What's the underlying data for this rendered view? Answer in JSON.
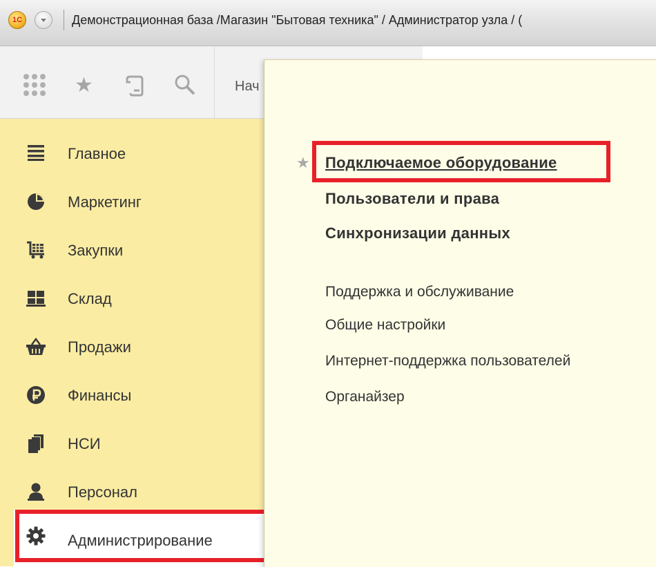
{
  "window": {
    "logo_text": "1C",
    "title": "Демонстрационная база /Магазин \"Бытовая техника\" / Администратор узла / ("
  },
  "toolbar": {
    "icons": [
      "apps-grid-icon",
      "star-icon",
      "history-icon",
      "search-icon"
    ],
    "home_tab_label": "Нач"
  },
  "sidebar": {
    "items": [
      {
        "label": "Главное",
        "icon": "menu-lines-icon"
      },
      {
        "label": "Маркетинг",
        "icon": "pie-chart-icon"
      },
      {
        "label": "Закупки",
        "icon": "cart-icon"
      },
      {
        "label": "Склад",
        "icon": "warehouse-icon"
      },
      {
        "label": "Продажи",
        "icon": "basket-icon"
      },
      {
        "label": "Финансы",
        "icon": "ruble-icon"
      },
      {
        "label": "НСИ",
        "icon": "documents-icon"
      },
      {
        "label": "Персонал",
        "icon": "person-icon"
      },
      {
        "label": "Администрирование",
        "icon": "gear-icon",
        "highlighted": true
      }
    ]
  },
  "submenu": {
    "bold_items": [
      {
        "label": "Подключаемое оборудование",
        "starred": true,
        "highlighted": true
      },
      {
        "label": "Пользователи и права"
      },
      {
        "label": "Синхронизации данных"
      }
    ],
    "items": [
      "Поддержка и обслуживание",
      "Общие настройки",
      "Интернет-поддержка пользователей",
      "Органайзер"
    ]
  },
  "colors": {
    "sidebar_bg": "#fbeca4",
    "submenu_bg": "#fefee8",
    "highlight_frame": "#e8202a"
  }
}
